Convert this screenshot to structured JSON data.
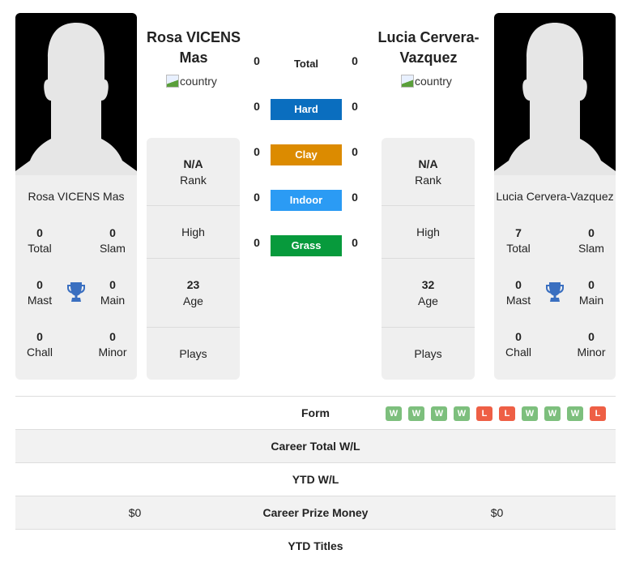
{
  "player1": {
    "name": "Rosa VICENS Mas",
    "flag_alt": "country",
    "info": {
      "rank": "N/A",
      "rank_label": "Rank",
      "high_label": "High",
      "age": "23",
      "age_label": "Age",
      "plays_label": "Plays"
    },
    "titles": {
      "total": "0",
      "total_label": "Total",
      "slam": "0",
      "slam_label": "Slam",
      "mast": "0",
      "mast_label": "Mast",
      "main": "0",
      "main_label": "Main",
      "chall": "0",
      "chall_label": "Chall",
      "minor": "0",
      "minor_label": "Minor"
    }
  },
  "player2": {
    "name": "Lucia Cervera-Vazquez",
    "flag_alt": "country",
    "info": {
      "rank": "N/A",
      "rank_label": "Rank",
      "high_label": "High",
      "age": "32",
      "age_label": "Age",
      "plays_label": "Plays"
    },
    "titles": {
      "total": "7",
      "total_label": "Total",
      "slam": "0",
      "slam_label": "Slam",
      "mast": "0",
      "mast_label": "Mast",
      "main": "0",
      "main_label": "Main",
      "chall": "0",
      "chall_label": "Chall",
      "minor": "0",
      "minor_label": "Minor"
    }
  },
  "h2h": [
    {
      "label": "Total",
      "p1": "0",
      "p2": "0",
      "color": ""
    },
    {
      "label": "Hard",
      "p1": "0",
      "p2": "0",
      "color": "#0a6ebf"
    },
    {
      "label": "Clay",
      "p1": "0",
      "p2": "0",
      "color": "#dc8b00"
    },
    {
      "label": "Indoor",
      "p1": "0",
      "p2": "0",
      "color": "#2b9bf4"
    },
    {
      "label": "Grass",
      "p1": "0",
      "p2": "0",
      "color": "#079a3c"
    }
  ],
  "comparison": {
    "form_label": "Form",
    "form": [
      "W",
      "W",
      "W",
      "W",
      "L",
      "L",
      "W",
      "W",
      "W",
      "L"
    ],
    "rows": [
      {
        "label": "Career Total W/L",
        "p1": "",
        "p2": ""
      },
      {
        "label": "YTD W/L",
        "p1": "",
        "p2": ""
      },
      {
        "label": "Career Prize Money",
        "p1": "$0",
        "p2": "$0"
      },
      {
        "label": "YTD Titles",
        "p1": "",
        "p2": ""
      }
    ]
  },
  "colors": {
    "win": "#7dbf7d",
    "loss": "#ee5f45",
    "trophy": "#3a6fc0"
  }
}
